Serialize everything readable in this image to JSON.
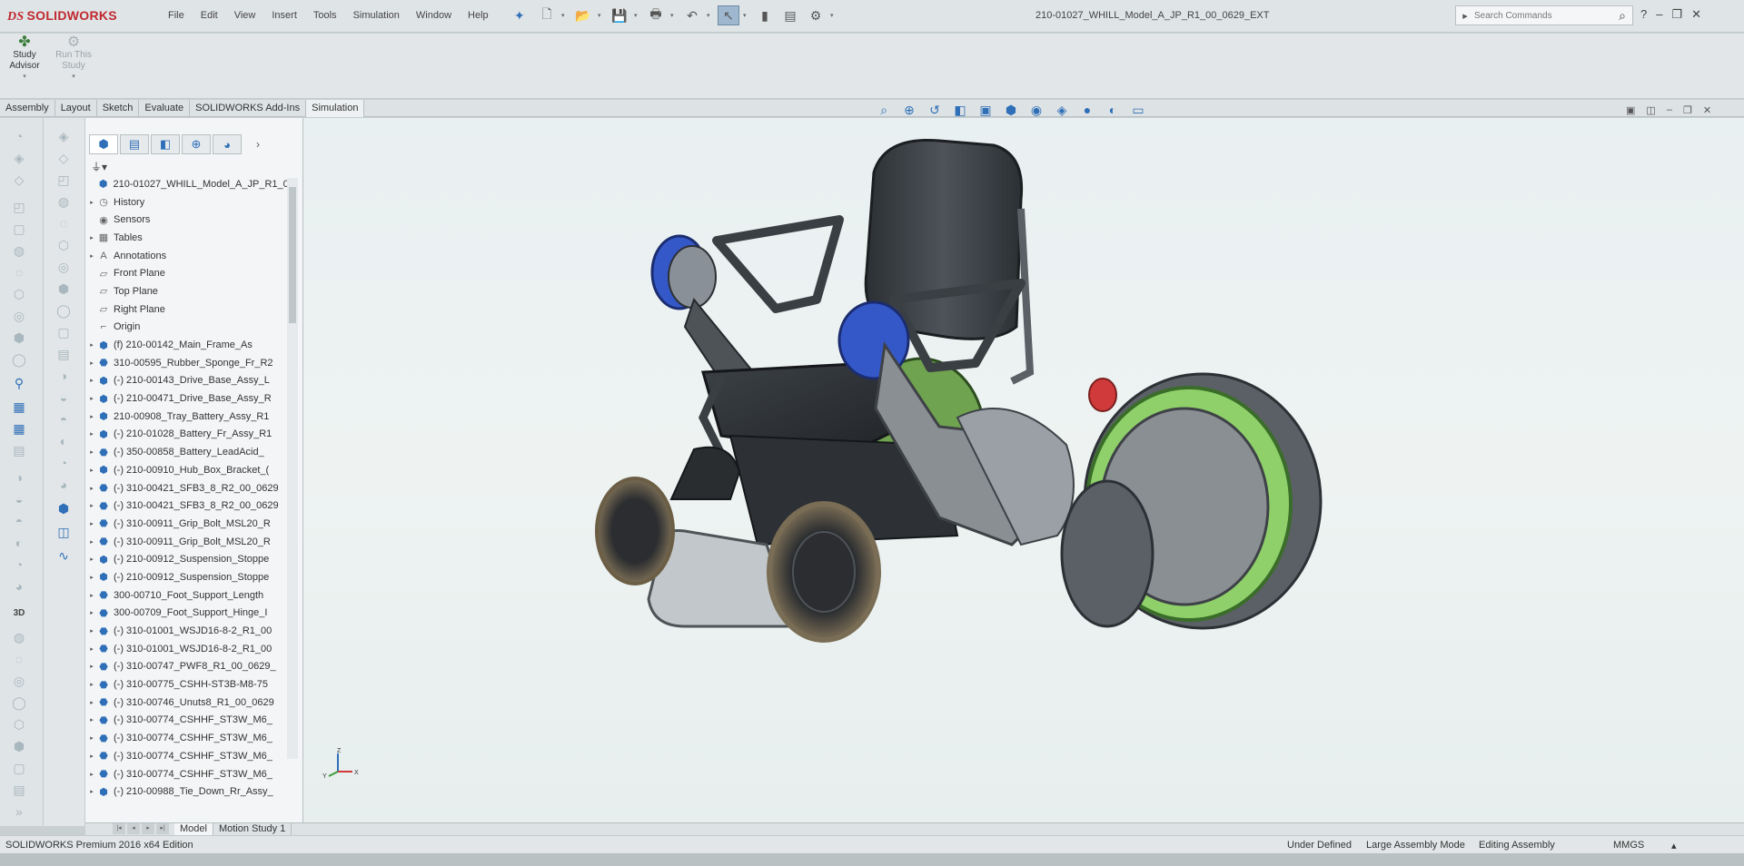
{
  "app": {
    "brand_prefix": "DS",
    "brand": "SOLIDWORKS"
  },
  "menu": [
    "File",
    "Edit",
    "View",
    "Insert",
    "Tools",
    "Simulation",
    "Window",
    "Help"
  ],
  "document_title": "210-01027_WHILL_Model_A_JP_R1_00_0629_EXT",
  "search": {
    "placeholder": "Search Commands"
  },
  "window_controls": {
    "help": "?",
    "minimize": "–",
    "restore": "❐",
    "close": "✕"
  },
  "ribbon": {
    "study_advisor": {
      "line1": "Study",
      "line2": "Advisor"
    },
    "run_study": {
      "line1": "Run This",
      "line2": "Study"
    }
  },
  "tabs": [
    "Assembly",
    "Layout",
    "Sketch",
    "Evaluate",
    "SOLIDWORKS Add-Ins",
    "Simulation"
  ],
  "active_tab": "Simulation",
  "feature_tree": {
    "root": "210-01027_WHILL_Model_A_JP_R1_00",
    "items": [
      {
        "label": "History",
        "icon": "history-icon",
        "exp": "▸"
      },
      {
        "label": "Sensors",
        "icon": "sensor-icon",
        "exp": ""
      },
      {
        "label": "Tables",
        "icon": "table-icon",
        "exp": "▸"
      },
      {
        "label": "Annotations",
        "icon": "annotation-icon",
        "exp": "▸"
      },
      {
        "label": "Front Plane",
        "icon": "plane-icon",
        "exp": ""
      },
      {
        "label": "Top Plane",
        "icon": "plane-icon",
        "exp": ""
      },
      {
        "label": "Right Plane",
        "icon": "plane-icon",
        "exp": ""
      },
      {
        "label": "Origin",
        "icon": "origin-icon",
        "exp": ""
      },
      {
        "label": "(f) 210-00142_Main_Frame_As",
        "icon": "assembly-icon",
        "exp": "▸"
      },
      {
        "label": "310-00595_Rubber_Sponge_Fr_R2",
        "icon": "part-icon",
        "exp": "▸"
      },
      {
        "label": "(-) 210-00143_Drive_Base_Assy_L",
        "icon": "assembly-icon",
        "exp": "▸"
      },
      {
        "label": "(-) 210-00471_Drive_Base_Assy_R",
        "icon": "assembly-icon",
        "exp": "▸"
      },
      {
        "label": "210-00908_Tray_Battery_Assy_R1",
        "icon": "assembly-icon",
        "exp": "▸"
      },
      {
        "label": "(-) 210-01028_Battery_Fr_Assy_R1",
        "icon": "assembly-icon",
        "exp": "▸"
      },
      {
        "label": "(-) 350-00858_Battery_LeadAcid_",
        "icon": "part-icon",
        "exp": "▸"
      },
      {
        "label": "(-) 210-00910_Hub_Box_Bracket_(",
        "icon": "assembly-icon",
        "exp": "▸"
      },
      {
        "label": "(-) 310-00421_SFB3_8_R2_00_0629",
        "icon": "part-icon",
        "exp": "▸"
      },
      {
        "label": "(-) 310-00421_SFB3_8_R2_00_0629",
        "icon": "part-icon",
        "exp": "▸"
      },
      {
        "label": "(-) 310-00911_Grip_Bolt_MSL20_R",
        "icon": "part-icon",
        "exp": "▸"
      },
      {
        "label": "(-) 310-00911_Grip_Bolt_MSL20_R",
        "icon": "part-icon",
        "exp": "▸"
      },
      {
        "label": "(-) 210-00912_Suspension_Stoppe",
        "icon": "assembly-icon",
        "exp": "▸"
      },
      {
        "label": "(-) 210-00912_Suspension_Stoppe",
        "icon": "assembly-icon",
        "exp": "▸"
      },
      {
        "label": "300-00710_Foot_Support_Length",
        "icon": "part-icon",
        "exp": "▸"
      },
      {
        "label": "300-00709_Foot_Support_Hinge_I",
        "icon": "part-icon",
        "exp": "▸"
      },
      {
        "label": "(-) 310-01001_WSJD16-8-2_R1_00",
        "icon": "part-icon",
        "exp": "▸"
      },
      {
        "label": "(-) 310-01001_WSJD16-8-2_R1_00",
        "icon": "part-icon",
        "exp": "▸"
      },
      {
        "label": "(-) 310-00747_PWF8_R1_00_0629_",
        "icon": "part-icon",
        "exp": "▸"
      },
      {
        "label": "(-) 310-00775_CSHH-ST3B-M8-75",
        "icon": "part-icon",
        "exp": "▸"
      },
      {
        "label": "(-) 310-00746_Unuts8_R1_00_0629",
        "icon": "part-icon",
        "exp": "▸"
      },
      {
        "label": "(-) 310-00774_CSHHF_ST3W_M6_",
        "icon": "part-icon",
        "exp": "▸"
      },
      {
        "label": "(-) 310-00774_CSHHF_ST3W_M6_",
        "icon": "part-icon",
        "exp": "▸"
      },
      {
        "label": "(-) 310-00774_CSHHF_ST3W_M6_",
        "icon": "part-icon",
        "exp": "▸"
      },
      {
        "label": "(-) 310-00774_CSHHF_ST3W_M6_",
        "icon": "part-icon",
        "exp": "▸"
      },
      {
        "label": "(-) 210-00988_Tie_Down_Rr_Assy_",
        "icon": "assembly-icon",
        "exp": "▸"
      }
    ]
  },
  "bottom_tabs": [
    "Model",
    "Motion Study 1"
  ],
  "triad": {
    "x": "X",
    "y": "Y",
    "z": "Z"
  },
  "status": {
    "edition": "SOLIDWORKS Premium 2016 x64 Edition",
    "state": "Under Defined",
    "mode": "Large Assembly Mode",
    "editing": "Editing Assembly",
    "units": "MMGS"
  },
  "colors": {
    "accent": "#2f6fb8",
    "brand": "#c0282f",
    "wheel_green": "#8fd06a",
    "frame_gray": "#4a4f55",
    "hub_blue": "#3558c8"
  }
}
